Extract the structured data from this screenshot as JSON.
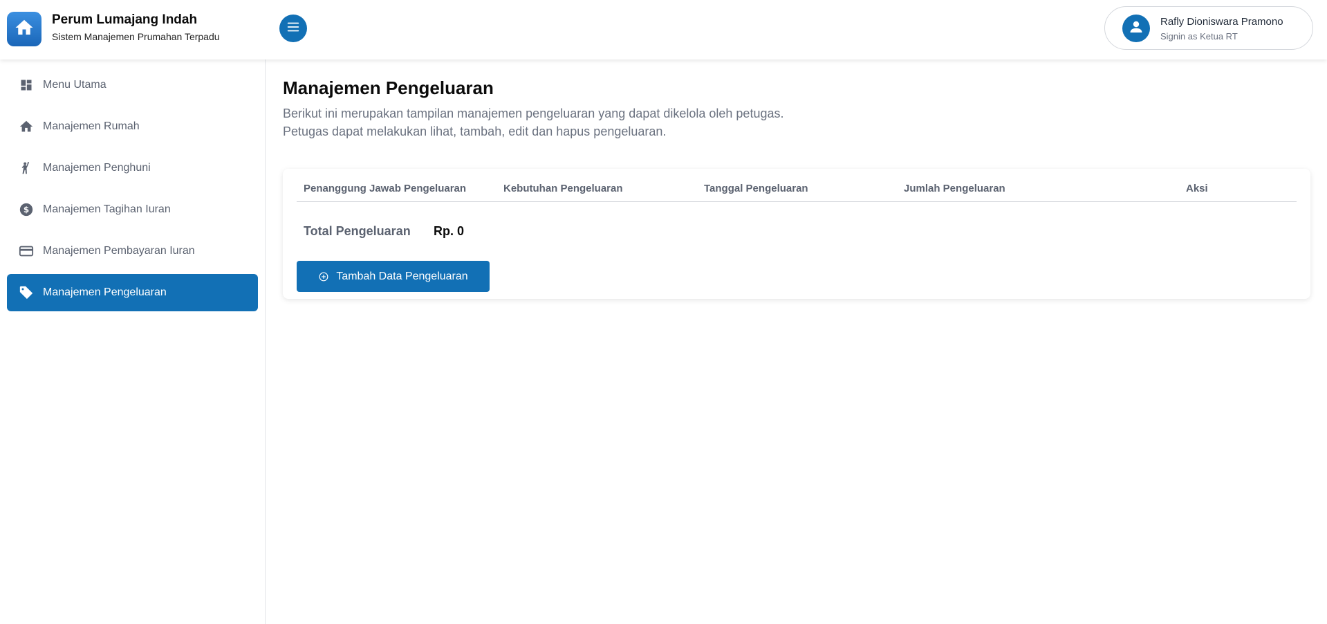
{
  "header": {
    "brand_title": "Perum Lumajang Indah",
    "brand_subtitle": "Sistem Manajemen Prumahan Terpadu",
    "user_name": "Rafly Dioniswara Pramono",
    "user_role": "Signin as Ketua RT"
  },
  "sidebar": {
    "items": [
      {
        "label": "Menu Utama",
        "icon": "dashboard-icon",
        "active": false
      },
      {
        "label": "Manajemen Rumah",
        "icon": "home-icon",
        "active": false
      },
      {
        "label": "Manajemen Penghuni",
        "icon": "person-wave-icon",
        "active": false
      },
      {
        "label": "Manajemen Tagihan Iuran",
        "icon": "dollar-circle-icon",
        "active": false
      },
      {
        "label": "Manajemen Pembayaran Iuran",
        "icon": "credit-card-icon",
        "active": false
      },
      {
        "label": "Manajemen Pengeluaran",
        "icon": "tag-icon",
        "active": true
      }
    ]
  },
  "main": {
    "title": "Manajemen Pengeluaran",
    "description": "Berikut ini merupakan tampilan manajemen pengeluaran yang dapat dikelola oleh petugas. Petugas dapat melakukan lihat, tambah, edit dan hapus pengeluaran.",
    "table": {
      "columns": [
        "Penanggung Jawab Pengeluaran",
        "Kebutuhan Pengeluaran",
        "Tanggal Pengeluaran",
        "Jumlah Pengeluaran",
        "Aksi"
      ],
      "rows": []
    },
    "total_label": "Total Pengeluaran",
    "total_value": "Rp. 0",
    "add_button_label": "Tambah Data Pengeluaran"
  },
  "colors": {
    "primary": "#1270b5",
    "text_muted": "#5b6270",
    "divider": "#d4d7dc"
  }
}
